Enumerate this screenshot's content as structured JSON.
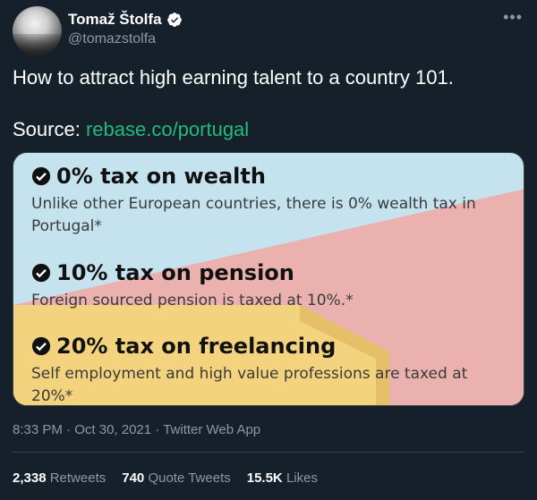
{
  "author": {
    "name": "Tomaž Štolfa",
    "handle": "@tomazstolfa"
  },
  "tweet": {
    "text": "How to attract high earning talent to a country 101.",
    "source_label": "Source:",
    "source_link": "rebase.co/portugal"
  },
  "card": {
    "items": [
      {
        "title": "0% tax on wealth",
        "desc": "Unlike other European countries, there is 0% wealth tax in Portugal*"
      },
      {
        "title": "10% tax on pension",
        "desc": "Foreign sourced pension is taxed at 10%.*"
      },
      {
        "title": "20% tax on freelancing",
        "desc": "Self employment and high value professions are taxed at 20%*"
      }
    ]
  },
  "meta": {
    "time": "8:33 PM",
    "date": "Oct 30, 2021",
    "app": "Twitter Web App"
  },
  "stats": {
    "retweets": "2,338",
    "retweets_label": "Retweets",
    "quotes": "740",
    "quotes_label": "Quote Tweets",
    "likes": "15.5K",
    "likes_label": "Likes"
  },
  "colors": {
    "background": "#15202b",
    "link": "#22bb7e",
    "muted": "#8b98a5"
  }
}
